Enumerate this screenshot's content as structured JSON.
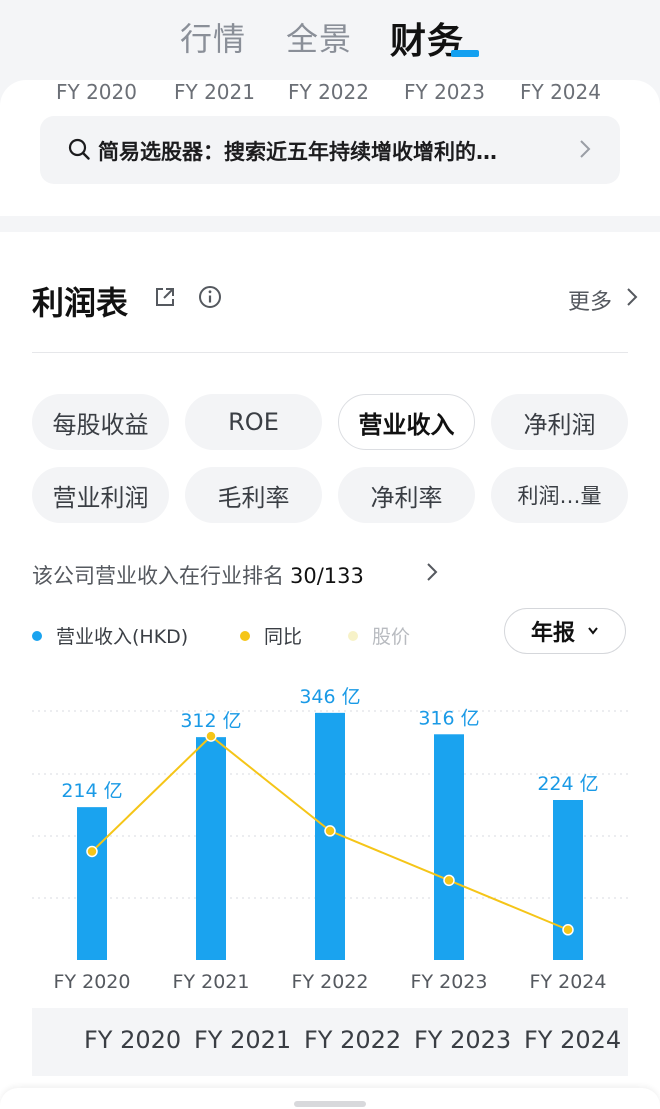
{
  "tabs": [
    {
      "label": "行情"
    },
    {
      "label": "全景"
    },
    {
      "label": "财务"
    }
  ],
  "years_top": [
    "FY 2020",
    "FY 2021",
    "FY 2022",
    "FY 2023",
    "FY 2024"
  ],
  "search": {
    "text": "简易选股器：搜索近五年持续增收增利的…"
  },
  "section": {
    "title": "利润表",
    "more": "更多"
  },
  "chips": [
    {
      "label": "每股收益"
    },
    {
      "label": "ROE"
    },
    {
      "label": "营业收入"
    },
    {
      "label": "净利润"
    },
    {
      "label": "营业利润"
    },
    {
      "label": "毛利率"
    },
    {
      "label": "净利率"
    },
    {
      "label": "利润…量"
    }
  ],
  "rank": {
    "text": "该公司营业收入在行业排名",
    "value": "30/133"
  },
  "legend": [
    {
      "label": "营业收入(HKD)",
      "color": "#1aa3ef"
    },
    {
      "label": "同比",
      "color": "#f5c518"
    },
    {
      "label": "股价",
      "color": "#f7f2c8"
    }
  ],
  "period": {
    "label": "年报"
  },
  "chart_data": {
    "type": "bar",
    "categories": [
      "FY 2020",
      "FY 2021",
      "FY 2022",
      "FY 2023",
      "FY 2024"
    ],
    "series": [
      {
        "name": "营业收入(HKD)",
        "values": [
          214,
          312,
          346,
          316,
          224
        ],
        "labels": [
          "214 亿",
          "312 亿",
          "346 亿",
          "316 亿",
          "224 亿"
        ],
        "color": "#1aa3ef"
      },
      {
        "name": "同比",
        "values": [
          0.42,
          0.98,
          0.52,
          0.28,
          0.04
        ],
        "color": "#f5c518"
      }
    ]
  },
  "table": {
    "headers": [
      "FY 2020",
      "FY 2021",
      "FY 2022",
      "FY 2023",
      "FY 2024"
    ]
  }
}
